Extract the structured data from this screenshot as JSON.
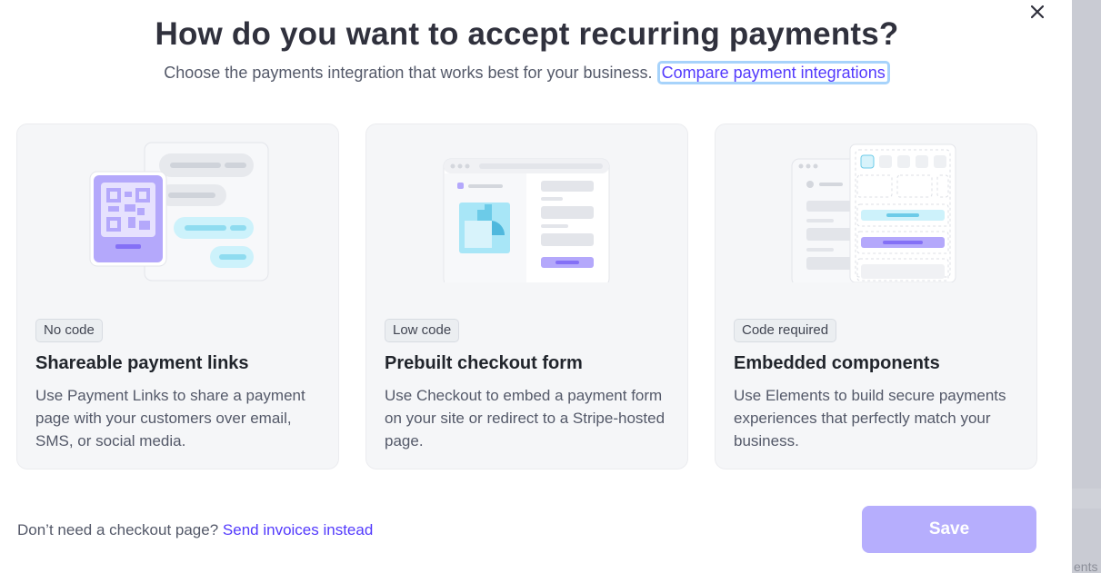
{
  "modal": {
    "title": "How do you want to accept recurring payments?",
    "subtitle": "Choose the payments integration that works best for your business.",
    "compare_link": "Compare payment integrations",
    "close_icon": "close-icon"
  },
  "cards": [
    {
      "badge": "No code",
      "title": "Shareable payment links",
      "description": "Use Payment Links to share a payment page with your customers over email, SMS, or social media.",
      "illustration": "qr-code-chat-illustration"
    },
    {
      "badge": "Low code",
      "title": "Prebuilt checkout form",
      "description": "Use Checkout to embed a payment form on your site or redirect to a Stripe-hosted page.",
      "illustration": "checkout-page-illustration"
    },
    {
      "badge": "Code required",
      "title": "Embedded components",
      "description": "Use Elements to build secure payments experiences that perfectly match your business.",
      "illustration": "embedded-components-illustration"
    }
  ],
  "footer": {
    "prompt": "Don’t need a checkout page?",
    "invoice_link": "Send invoices instead",
    "save_label": "Save"
  },
  "background": {
    "partial_text": "ents"
  },
  "colors": {
    "accent": "#533afd",
    "save_disabled": "#b6aefd",
    "card_bg": "#f5f6f8",
    "focus_ring": "#a7d3fb"
  }
}
